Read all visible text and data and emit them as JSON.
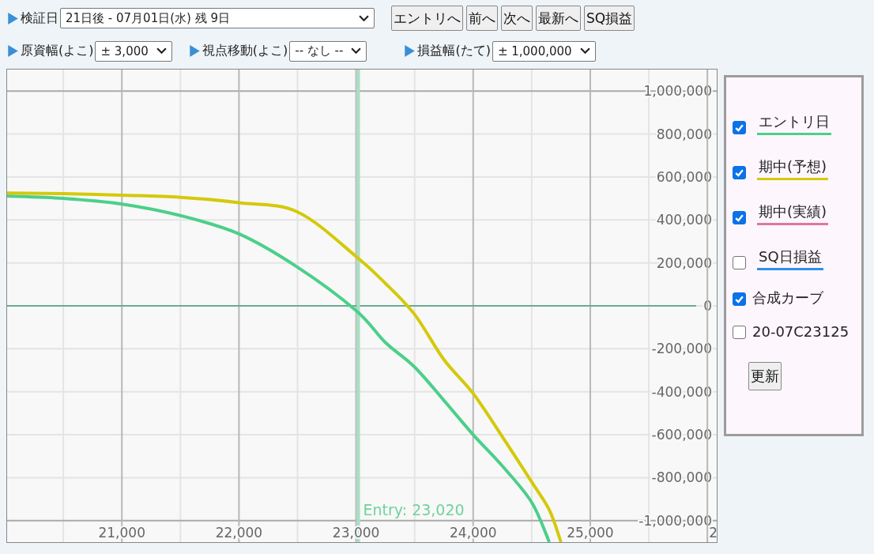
{
  "controls_row_1": {
    "label": "検証日",
    "date_select": {
      "value": "21日後 - 07月01日(水) 残 9日"
    },
    "buttons": [
      "エントリへ",
      "前へ",
      "次へ",
      "最新へ",
      "SQ損益"
    ]
  },
  "controls_row_2": [
    {
      "label": "原資幅(よこ)",
      "value": "± 3,000"
    },
    {
      "label": "視点移動(よこ)",
      "value": "-- なし --"
    },
    {
      "label": "損益幅(たて)",
      "value": "± 1,000,000"
    }
  ],
  "chart": {
    "chart_data": {
      "type": "line",
      "x": [
        20020,
        20500,
        21000,
        21500,
        22000,
        22500,
        23000,
        23250,
        23500,
        23750,
        24000,
        24250,
        24500,
        24650,
        24750
      ],
      "series": [
        {
          "color": "#4ccf8a",
          "values": [
            511000,
            500000,
            474000,
            420000,
            335000,
            180000,
            -22000,
            -170000,
            -285000,
            -440000,
            -600000,
            -746000,
            -915000,
            -1100000,
            null
          ]
        },
        {
          "color": "#d4c90a",
          "values": [
            525000,
            522000,
            515000,
            505000,
            480000,
            437000,
            230000,
            105000,
            -40000,
            -250000,
            -408000,
            -610000,
            -820000,
            -950000,
            -1100000
          ]
        }
      ],
      "grid": true,
      "xlim": [
        20020,
        26080
      ],
      "ylim": [
        -1100000,
        1100000
      ],
      "xticks": [
        {
          "value": 21000,
          "label": "21,000"
        },
        {
          "value": 22000,
          "label": "22,000"
        },
        {
          "value": 23000,
          "label": "23,000"
        },
        {
          "value": 24000,
          "label": "24,000"
        },
        {
          "value": 25000,
          "label": "25,000"
        }
      ],
      "yticks": [
        {
          "value": 1000000,
          "label": "1,000,000"
        },
        {
          "value": 800000,
          "label": "800,000"
        },
        {
          "value": 600000,
          "label": "600,000"
        },
        {
          "value": 400000,
          "label": "400,000"
        },
        {
          "value": 200000,
          "label": "200,000"
        },
        {
          "value": 0,
          "label": "0"
        },
        {
          "value": -200000,
          "label": "-200,000"
        },
        {
          "value": -400000,
          "label": "-400,000"
        },
        {
          "value": -600000,
          "label": "-600,000"
        },
        {
          "value": -800000,
          "label": "-800,000"
        },
        {
          "value": -1000000,
          "label": "-1,000,000"
        }
      ],
      "ref_lines": [
        {
          "axis": "y",
          "value": 0
        },
        {
          "axis": "x",
          "value": 23020,
          "label": "Entry: 23,020"
        }
      ]
    },
    "cut_x_label": "2"
  },
  "legend": {
    "items": [
      {
        "kind": "series",
        "label": "エントリ日",
        "checked": true,
        "color": "#4ccf8a"
      },
      {
        "kind": "series",
        "label": "期中(予想)",
        "checked": true,
        "color": "#d4c90a"
      },
      {
        "kind": "series",
        "label": "期中(実績)",
        "checked": true,
        "color": "#e0789a"
      },
      {
        "kind": "series",
        "label": "SQ日損益",
        "checked": false,
        "color": "#2f8fe8"
      },
      {
        "kind": "plain",
        "label": "合成カーブ",
        "checked": true
      },
      {
        "kind": "plain",
        "label": "20-07C23125",
        "checked": false
      }
    ],
    "update_button": "更新"
  }
}
